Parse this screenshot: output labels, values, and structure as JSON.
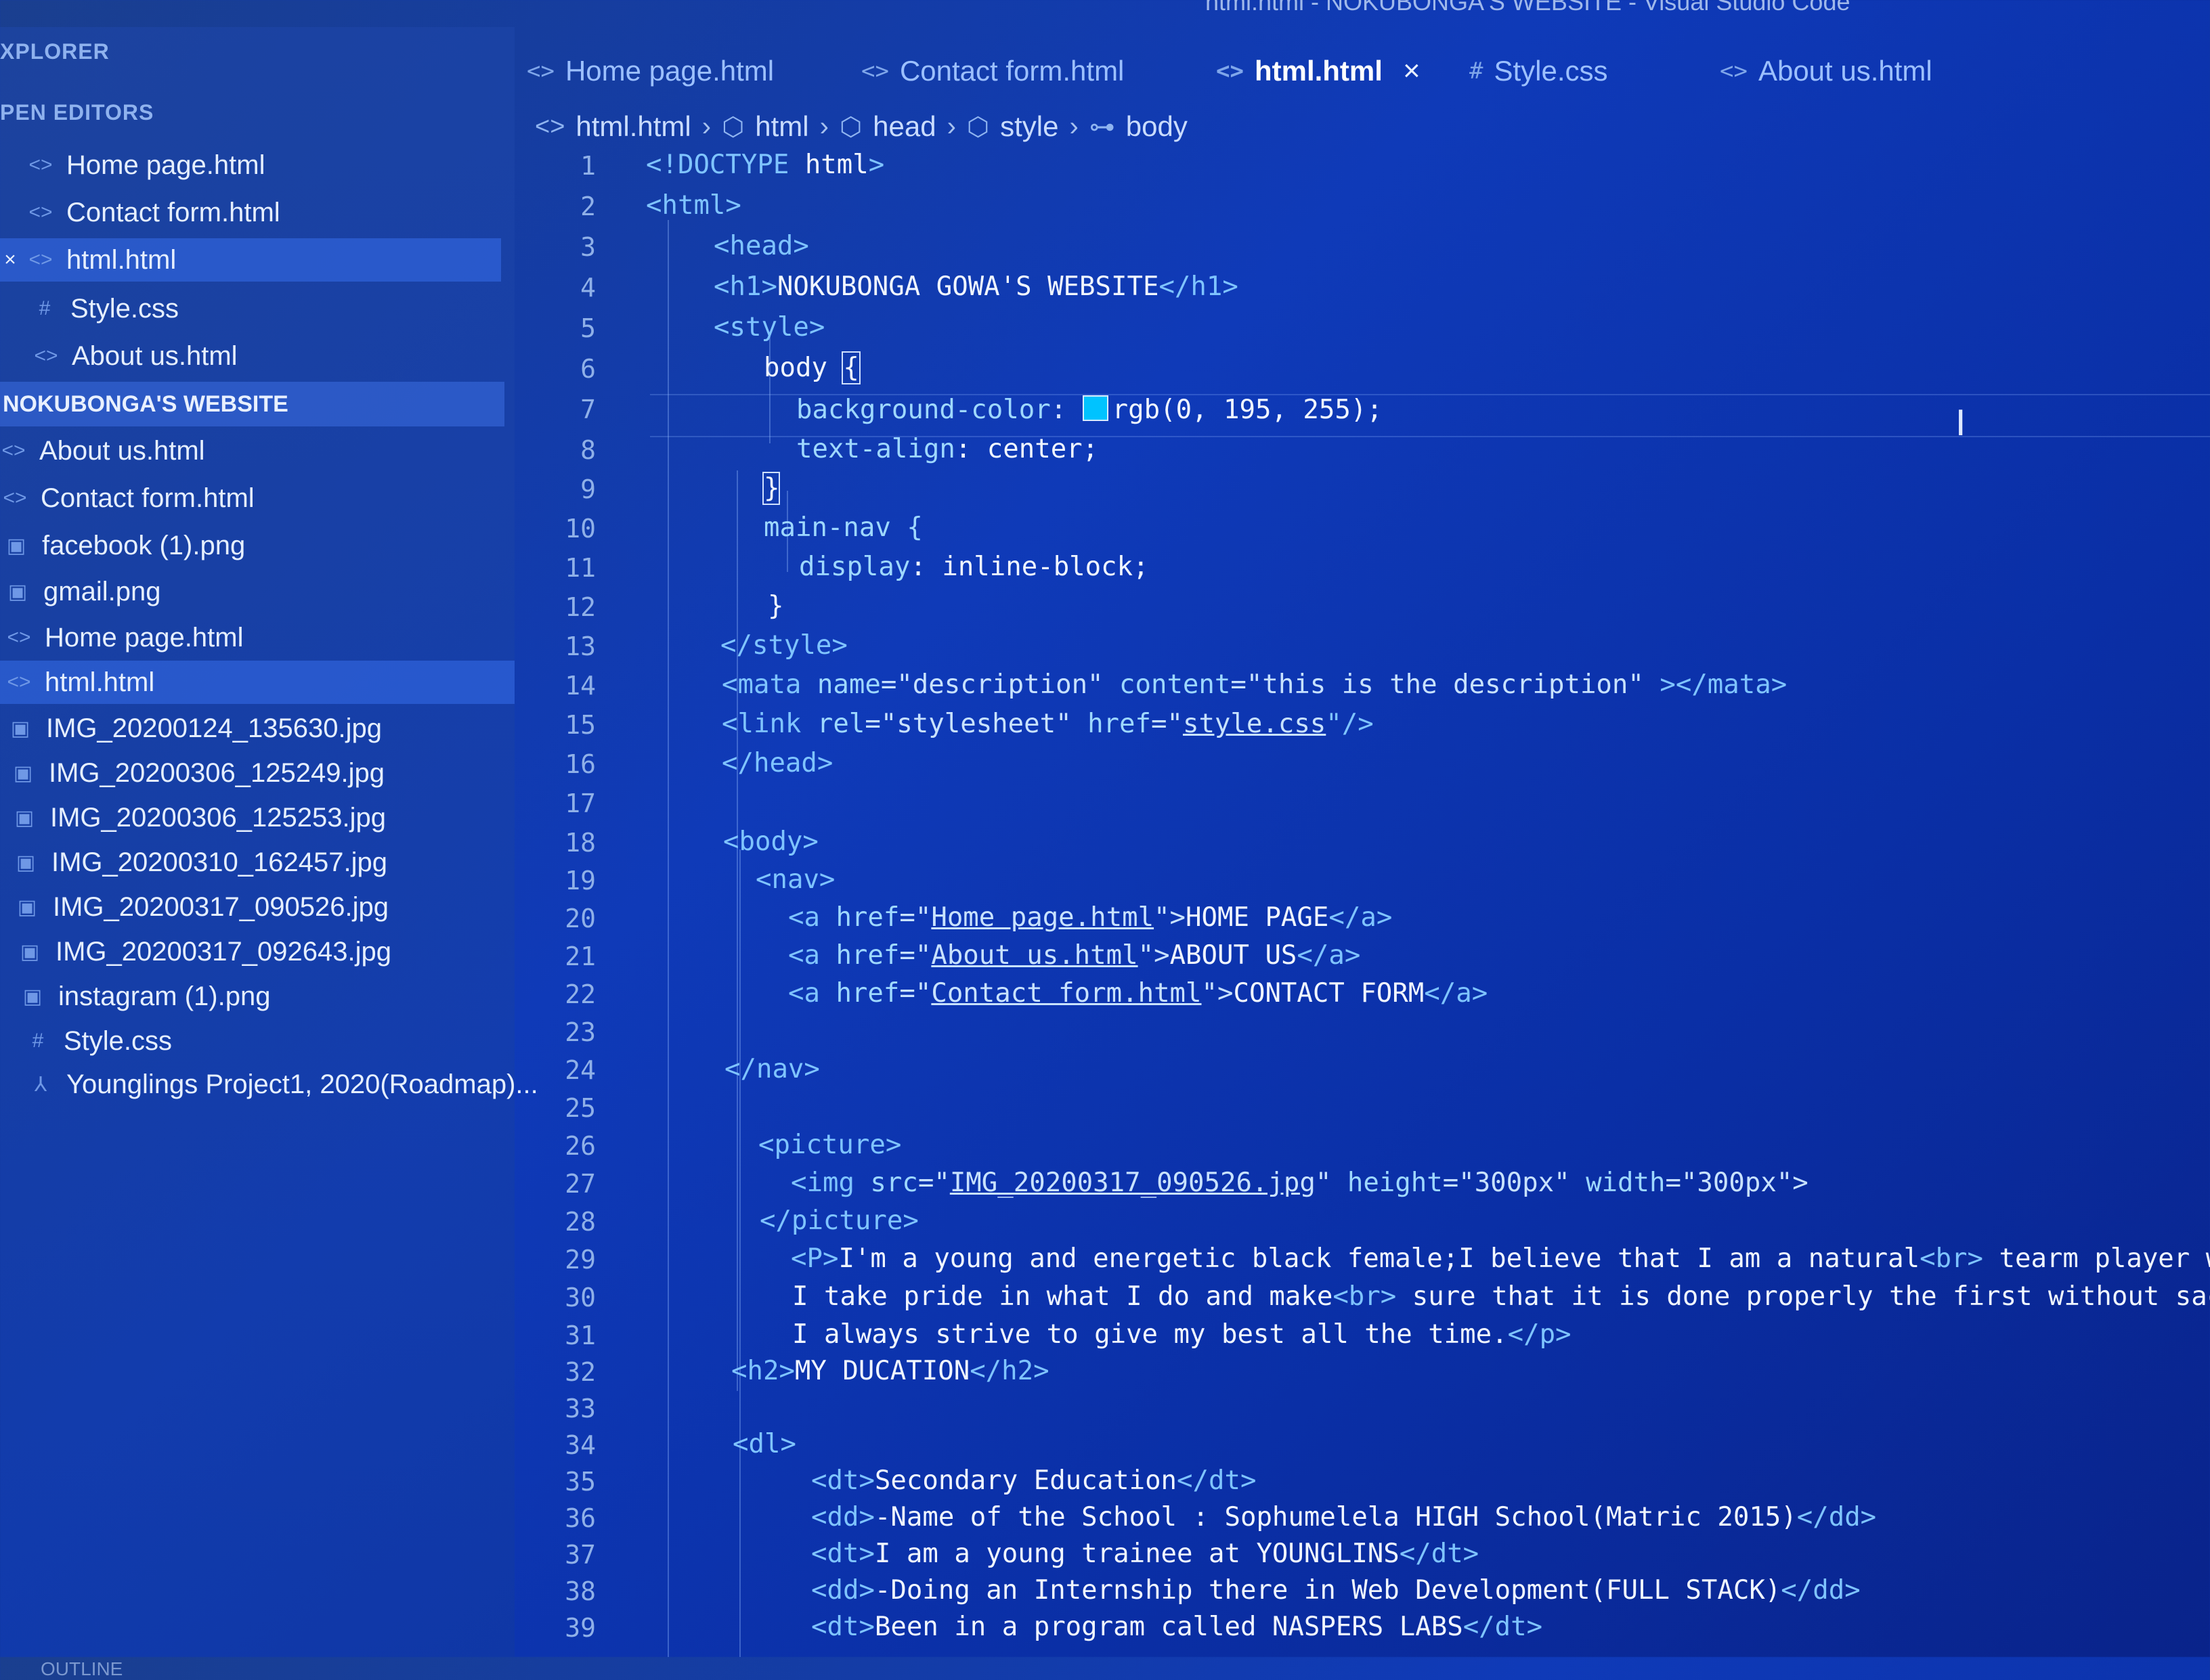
{
  "title_bar": "html.html - NOKUBONGA'S WEBSITE - Visual Studio Code",
  "sidebar": {
    "explorer_label": "XPLORER",
    "open_editors_label": "PEN EDITORS",
    "open_editors": [
      {
        "label": "Home page.html",
        "icon": "html-file-icon"
      },
      {
        "label": "Contact form.html",
        "icon": "html-file-icon"
      },
      {
        "label": "html.html",
        "icon": "html-file-icon",
        "selected": true
      },
      {
        "label": "Style.css",
        "icon": "css-file-icon"
      },
      {
        "label": "About us.html",
        "icon": "html-file-icon"
      }
    ],
    "project_label": "NOKUBONGA'S WEBSITE",
    "files": [
      {
        "label": "About us.html",
        "icon": "html-file-icon"
      },
      {
        "label": "Contact form.html",
        "icon": "html-file-icon"
      },
      {
        "label": "facebook (1).png",
        "icon": "image-file-icon"
      },
      {
        "label": "gmail.png",
        "icon": "image-file-icon"
      },
      {
        "label": "Home page.html",
        "icon": "html-file-icon"
      },
      {
        "label": "html.html",
        "icon": "html-file-icon",
        "selected": true
      },
      {
        "label": "IMG_20200124_135630.jpg",
        "icon": "image-file-icon"
      },
      {
        "label": "IMG_20200306_125249.jpg",
        "icon": "image-file-icon"
      },
      {
        "label": "IMG_20200306_125253.jpg",
        "icon": "image-file-icon"
      },
      {
        "label": "IMG_20200310_162457.jpg",
        "icon": "image-file-icon"
      },
      {
        "label": "IMG_20200317_090526.jpg",
        "icon": "image-file-icon"
      },
      {
        "label": "IMG_20200317_092643.jpg",
        "icon": "image-file-icon"
      },
      {
        "label": "instagram (1).png",
        "icon": "image-file-icon"
      },
      {
        "label": "Style.css",
        "icon": "css-file-icon"
      },
      {
        "label": "Younglings Project1, 2020(Roadmap)...",
        "icon": "pdf-file-icon"
      }
    ],
    "outline_label": "OUTLINE"
  },
  "tabs": [
    {
      "label": "Home page.html",
      "icon": "<>"
    },
    {
      "label": "Contact form.html",
      "icon": "<>"
    },
    {
      "label": "html.html",
      "icon": "<>",
      "active": true,
      "close": "×"
    },
    {
      "label": "Style.css",
      "icon": "#"
    },
    {
      "label": "About us.html",
      "icon": "<>"
    }
  ],
  "breadcrumb": [
    "html.html",
    "html",
    "head",
    "style",
    "body"
  ],
  "line_numbers": [
    "1",
    "2",
    "3",
    "4",
    "5",
    "6",
    "7",
    "8",
    "9",
    "10",
    "11",
    "12",
    "13",
    "14",
    "15",
    "16",
    "17",
    "18",
    "19",
    "20",
    "21",
    "22",
    "23",
    "24",
    "25",
    "26",
    "27",
    "28",
    "29",
    "30",
    "31",
    "32",
    "33",
    "34",
    "35",
    "36",
    "37",
    "38",
    "39"
  ],
  "code": {
    "l1_a": "<!DOCTYPE ",
    "l1_b": "html",
    "l1_c": ">",
    "l2": "<html>",
    "l3": "<head>",
    "l4_a": "<h1>",
    "l4_b": "NOKUBONGA GOWA'S WEBSITE",
    "l4_c": "</h1>",
    "l5": "<style>",
    "l6_a": "body ",
    "l6_b": "{",
    "l7_a": "background-color",
    "l7_b": ": ",
    "l7_c": "rgb(0, 195, 255);",
    "l8_a": "text-align",
    "l8_b": ": center;",
    "l9": "}",
    "l10": "main-nav {",
    "l11_a": "display",
    "l11_b": ": inline-block;",
    "l12": "}",
    "l13": "</style>",
    "l14_a": "<mata ",
    "l14_b": "name",
    "l14_c": "=\"description\" ",
    "l14_d": "content",
    "l14_e": "=\"this is the description\" ",
    "l14_f": "></mata>",
    "l15_a": "<link ",
    "l15_b": "rel",
    "l15_c": "=\"stylesheet\" ",
    "l15_d": "href",
    "l15_e": "=\"",
    "l15_f": "style.css",
    "l15_g": "\"/>",
    "l16": "</head>",
    "l18": "<body>",
    "l19": "<nav>",
    "l20_a": "<a ",
    "l20_b": "href",
    "l20_c": "=\"",
    "l20_d": "Home page.html",
    "l20_e": "\">",
    "l20_f": "HOME PAGE",
    "l20_g": "</a>",
    "l21_a": "<a ",
    "l21_b": "href",
    "l21_c": "=\"",
    "l21_d": "About us.html",
    "l21_e": "\">",
    "l21_f": "ABOUT US",
    "l21_g": "</a>",
    "l22_a": "<a ",
    "l22_b": "href",
    "l22_c": "=\"",
    "l22_d": "Contact form.html",
    "l22_e": "\">",
    "l22_f": "CONTACT FORM",
    "l22_g": "</a>",
    "l24": "</nav>",
    "l26": "<picture>",
    "l27_a": "<img ",
    "l27_b": "src",
    "l27_c": "=\"",
    "l27_d": "IMG_20200317_090526.jpg",
    "l27_e": "\" ",
    "l27_f": "height",
    "l27_g": "=\"300px\" ",
    "l27_h": "width",
    "l27_i": "=\"300px\">",
    "l28": "</picture>",
    "l29_a": "<P>",
    "l29_b": "I'm a young and energetic black female;I believe that I am a natural",
    "l29_c": "<br>",
    "l29_d": " tearm player who i",
    "l30_a": "I take pride in what I do and make",
    "l30_b": "<br>",
    "l30_c": " sure that it is done properly the first without sacrifi",
    "l31_a": "I always strive to give my best all the time.",
    "l31_b": "</p>",
    "l32_a": "<h2>",
    "l32_b": "MY DUCATION",
    "l32_c": "</h2>",
    "l34": "<dl>",
    "l35_a": "<dt>",
    "l35_b": "Secondary Education",
    "l35_c": "</dt>",
    "l36_a": "<dd>",
    "l36_b": "-Name of the School : Sophumelela HIGH School(Matric 2015)",
    "l36_c": "</dd>",
    "l37_a": "<dt>",
    "l37_b": "I am a young trainee at YOUNGLINS",
    "l37_c": "</dt>",
    "l38_a": "<dd>",
    "l38_b": "-Doing an Internship there in Web Development(FULL STACK)",
    "l38_c": "</dd>",
    "l39_a": "<dt>",
    "l39_b": "Been in a program called NASPERS LABS",
    "l39_c": "</dt>"
  },
  "colors": {
    "swatch": "#00c3ff",
    "accent": "#3c6ee1"
  }
}
